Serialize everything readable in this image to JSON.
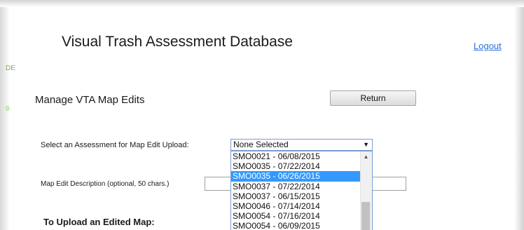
{
  "app": {
    "title": "Visual Trash Assessment Database",
    "logout": "Logout"
  },
  "sidebar_clip": {
    "text_a": "DE",
    "text_b": "g."
  },
  "page": {
    "section_title": "Manage VTA Map Edits",
    "return_label": "Return"
  },
  "assessment_select": {
    "label": "Select an Assessment for Map Edit Upload:",
    "selected": "None Selected",
    "options": [
      "SMO0021 - 06/08/2015",
      "SMO0035 - 07/22/2014",
      "SMO0035 - 06/26/2015",
      "SMO0037 - 07/22/2014",
      "SMO0037 - 06/15/2015",
      "SMO0046 - 07/14/2014",
      "SMO0054 - 07/16/2014",
      "SMO0054 - 06/09/2015"
    ],
    "highlighted": "SMO0035 - 06/26/2015"
  },
  "description": {
    "label": "Map Edit Description (optional, 50 chars.)",
    "value": ""
  },
  "upload": {
    "heading": "To Upload an Edited Map:"
  }
}
